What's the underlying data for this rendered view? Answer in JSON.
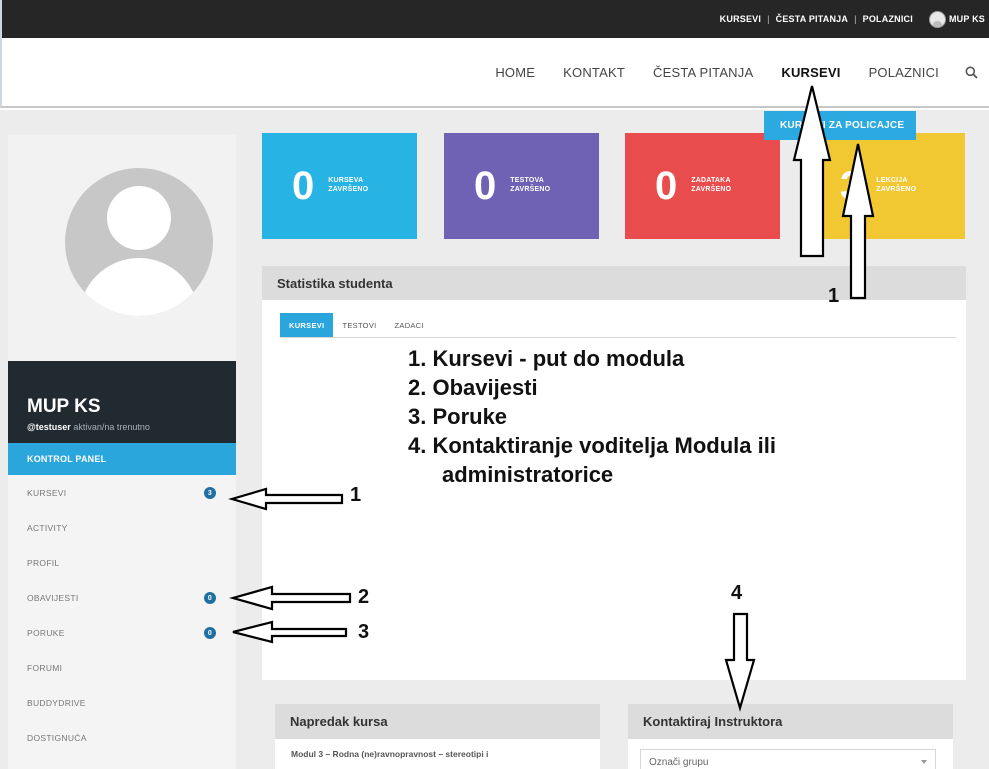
{
  "topbar": {
    "links": [
      "KURSEVI",
      "ČESTA PITANJA",
      "POLAZNICI"
    ],
    "user_label": "MUP KS"
  },
  "nav": {
    "items": [
      "HOME",
      "KONTAKT",
      "ČESTA PITANJA",
      "KURSEVI",
      "POLAZNICI"
    ],
    "active": "KURSEVI",
    "search_icon": "search-icon"
  },
  "dropdown": {
    "item": "KURSEVI ZA POLICAJCE"
  },
  "colors": {
    "accent": "#2ba6dd",
    "card_blue": "#27b4e5",
    "card_purple": "#6f62b4",
    "card_red": "#e94c4c",
    "card_yellow": "#f2c832",
    "dark": "#222a31"
  },
  "cards": [
    {
      "num": "0",
      "line1": "KURSEVA",
      "line2": "ZAVRŠENO"
    },
    {
      "num": "0",
      "line1": "TESTOVA",
      "line2": "ZAVRŠENO"
    },
    {
      "num": "0",
      "line1": "ZADATAKA",
      "line2": "ZAVRŠENO"
    },
    {
      "num": "3",
      "line1": "LEKCIJA",
      "line2": "ZAVRŠENO"
    }
  ],
  "profile": {
    "name": "MUP KS",
    "username": "@testuser",
    "status": "aktivan/na trenutno"
  },
  "sidebar": {
    "active": "KONTROL PANEL",
    "items": [
      {
        "label": "KURSEVI",
        "badge": "3"
      },
      {
        "label": "ACTIVITY",
        "badge": ""
      },
      {
        "label": "PROFIL",
        "badge": ""
      },
      {
        "label": "OBAVIJESTI",
        "badge": "0"
      },
      {
        "label": "PORUKE",
        "badge": "0"
      },
      {
        "label": "FORUMI",
        "badge": ""
      },
      {
        "label": "BUDDYDRIVE",
        "badge": ""
      },
      {
        "label": "DOSTIGNUĆA",
        "badge": ""
      }
    ]
  },
  "stats": {
    "title": "Statistika studenta",
    "tabs": [
      "KURSEVI",
      "TESTOVI",
      "ZADACI"
    ],
    "active_tab": "KURSEVI"
  },
  "legend": [
    "1. Kursevi - put do modula",
    "2. Obavijesti",
    "3. Poruke",
    "4. Kontaktiranje voditelja Modula ili",
    "administratorice"
  ],
  "annotations": {
    "a1_top": "1",
    "a1_side": "1",
    "a2": "2",
    "a3": "3",
    "a4": "4"
  },
  "progress": {
    "title": "Napredak kursa",
    "course": "Modul 3 – Rodna (ne)ravnopravnost – stereotipi i"
  },
  "contact": {
    "title": "Kontaktiraj Instruktora",
    "select_value": "Označi grupu"
  }
}
